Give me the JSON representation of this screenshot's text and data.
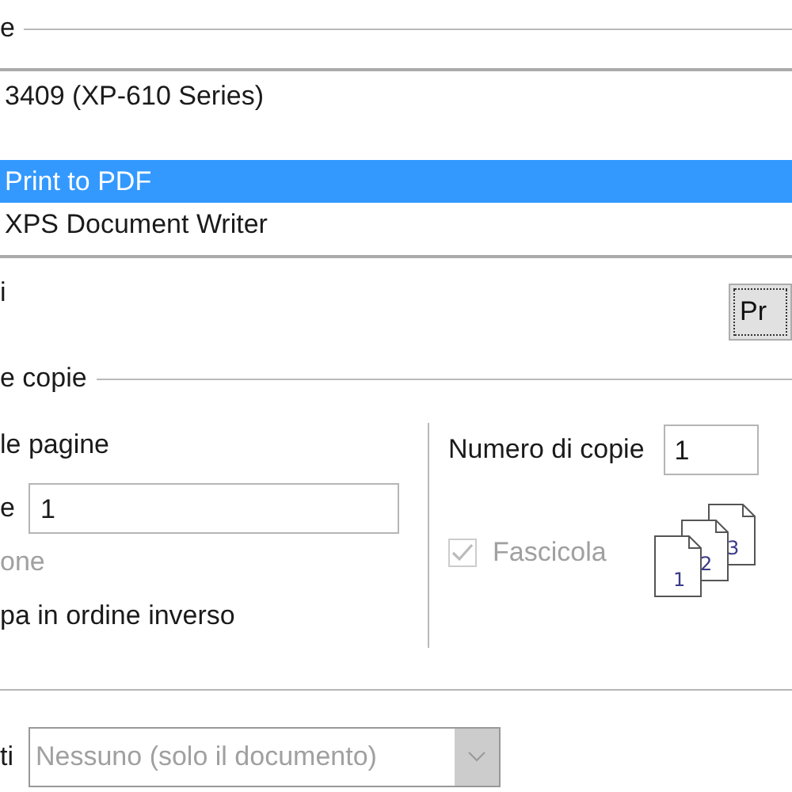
{
  "printer_group": {
    "title": "e"
  },
  "printers": [
    {
      "name": "3409 (XP-610 Series)",
      "selected": false
    },
    {
      "name": "Print to PDF",
      "selected": true
    },
    {
      "name": "XPS Document Writer",
      "selected": false
    }
  ],
  "properties_label": "i",
  "properties_button": "Pr",
  "copies_group": {
    "title": "e copie"
  },
  "range": {
    "all_label": "le pagine",
    "pages_label": "e",
    "pages_value": "1",
    "selection_label": "one",
    "selection_disabled": true,
    "reverse_label": "pa in ordine inverso"
  },
  "copies": {
    "label": "Numero di copie",
    "value": "1",
    "collate_label": "Fascicola",
    "collate_checked": true,
    "collate_disabled": true,
    "collate_pages": [
      "1",
      "2",
      "3"
    ]
  },
  "comments": {
    "label": "ti",
    "value": "Nessuno (solo il documento)",
    "disabled": true
  }
}
